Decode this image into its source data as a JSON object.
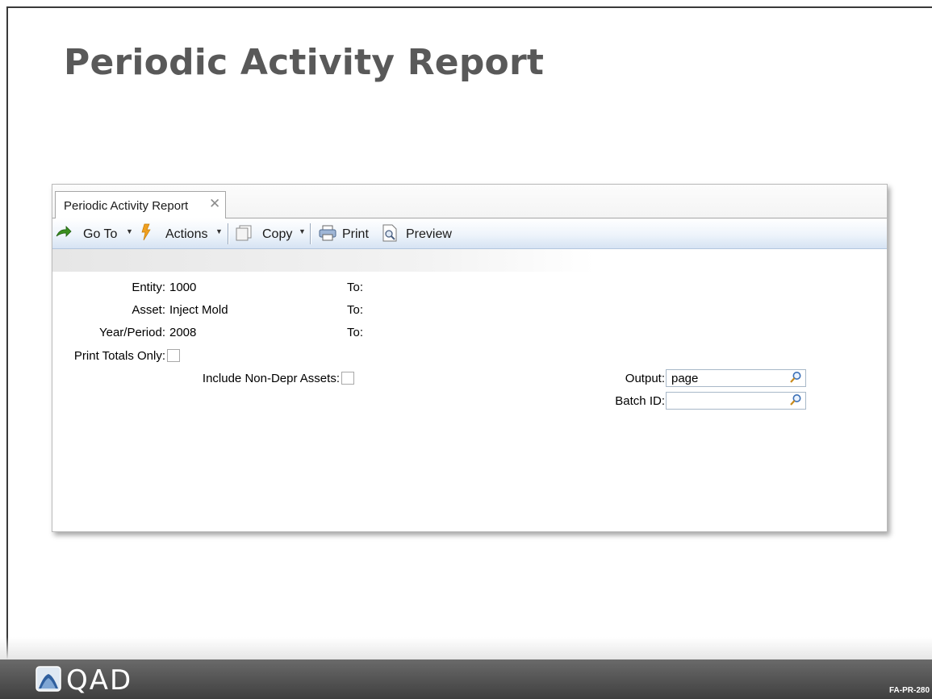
{
  "slide": {
    "title": "Periodic Activity Report",
    "code": "FA-PR-280"
  },
  "window": {
    "tab_label": "Periodic Activity Report",
    "tab_close": "✕"
  },
  "toolbar": {
    "goto_label": "Go To",
    "actions_label": "Actions",
    "copy_label": "Copy",
    "print_label": "Print",
    "preview_label": "Preview",
    "caret": "▼"
  },
  "form": {
    "entity_label": "Entity:",
    "entity_value": "1000",
    "entity_to_label": "To:",
    "asset_label": "Asset:",
    "asset_value": "Inject Mold",
    "asset_to_label": "To:",
    "year_period_label": "Year/Period:",
    "year_period_value": "2008",
    "year_period_to_label": "To:",
    "print_totals_label": "Print Totals Only:",
    "print_totals_checked": false,
    "include_non_depr_label": "Include Non-Depr Assets:",
    "include_non_depr_checked": false,
    "output_label": "Output:",
    "output_value": "page",
    "batch_id_label": "Batch ID:",
    "batch_id_value": ""
  },
  "footer": {
    "logo_text": "QAD"
  },
  "colors": {
    "title": "#595959",
    "toolbar_blue": "#d6e3f3",
    "footer_dark": "#4a4a4a",
    "goto_arrow_green": "#3a8f1e",
    "actions_orange": "#f0a020"
  },
  "icons": [
    "goto-arrow-icon",
    "actions-flash-icon",
    "copy-icon",
    "print-icon",
    "preview-icon",
    "lookup-magnifier-icon",
    "close-icon",
    "qad-logo-icon"
  ]
}
